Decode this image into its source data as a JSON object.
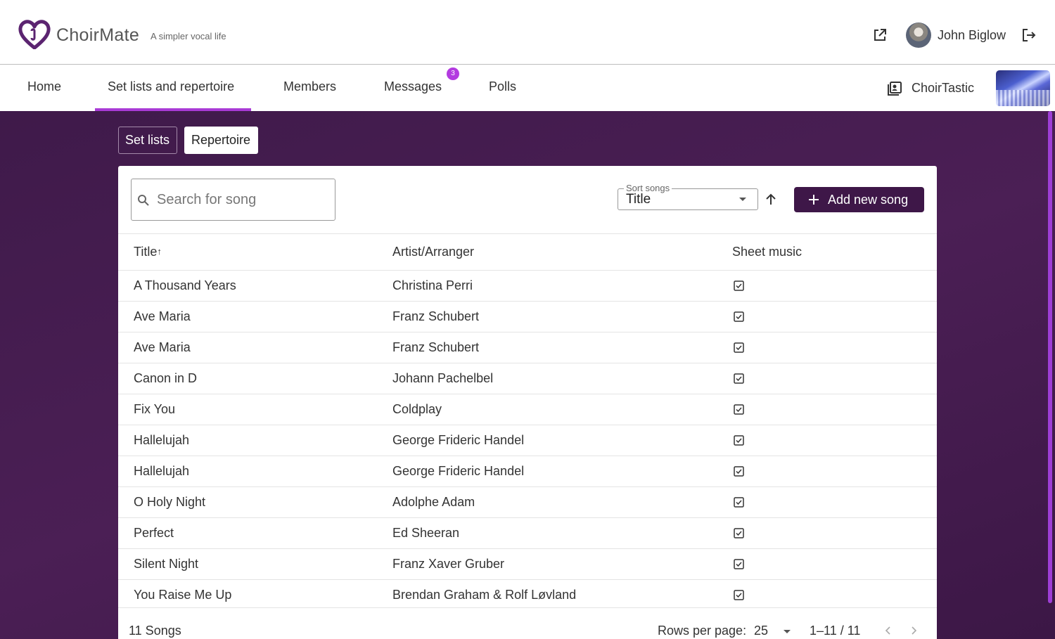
{
  "app": {
    "brand": "ChoirMate",
    "tagline": "A simpler vocal life",
    "user_name": "John Biglow"
  },
  "nav": {
    "items": [
      {
        "label": "Home"
      },
      {
        "label": "Set lists and repertoire"
      },
      {
        "label": "Members"
      },
      {
        "label": "Messages"
      },
      {
        "label": "Polls"
      }
    ],
    "messages_badge": "3",
    "choir_name": "ChoirTastic"
  },
  "subtabs": {
    "set_lists": "Set lists",
    "repertoire": "Repertoire"
  },
  "toolbar": {
    "search_placeholder": "Search for song",
    "sort_label": "Sort songs",
    "sort_value": "Title",
    "add_label": "Add new song"
  },
  "table": {
    "headers": {
      "title": "Title",
      "artist": "Artist/Arranger",
      "sheet": "Sheet music"
    },
    "rows": [
      {
        "title": "A Thousand Years",
        "artist": "Christina Perri"
      },
      {
        "title": "Ave Maria",
        "artist": "Franz Schubert"
      },
      {
        "title": "Ave Maria",
        "artist": "Franz Schubert"
      },
      {
        "title": "Canon in D",
        "artist": "Johann Pachelbel"
      },
      {
        "title": "Fix You",
        "artist": "Coldplay"
      },
      {
        "title": "Hallelujah",
        "artist": "George Frideric Handel"
      },
      {
        "title": "Hallelujah",
        "artist": "George Frideric Handel"
      },
      {
        "title": "O Holy Night",
        "artist": "Adolphe Adam"
      },
      {
        "title": "Perfect",
        "artist": "Ed Sheeran"
      },
      {
        "title": "Silent Night",
        "artist": "Franz Xaver Gruber"
      },
      {
        "title": "You Raise Me Up",
        "artist": "Brendan Graham & Rolf Løvland"
      }
    ]
  },
  "footer": {
    "count": "11 Songs",
    "rows_per_page_label": "Rows per page:",
    "rows_per_page_value": "25",
    "range": "1–11 / 11"
  },
  "colors": {
    "accent": "#a93bd6",
    "primary_dark": "#3e1748",
    "background": "#4b1f55"
  }
}
